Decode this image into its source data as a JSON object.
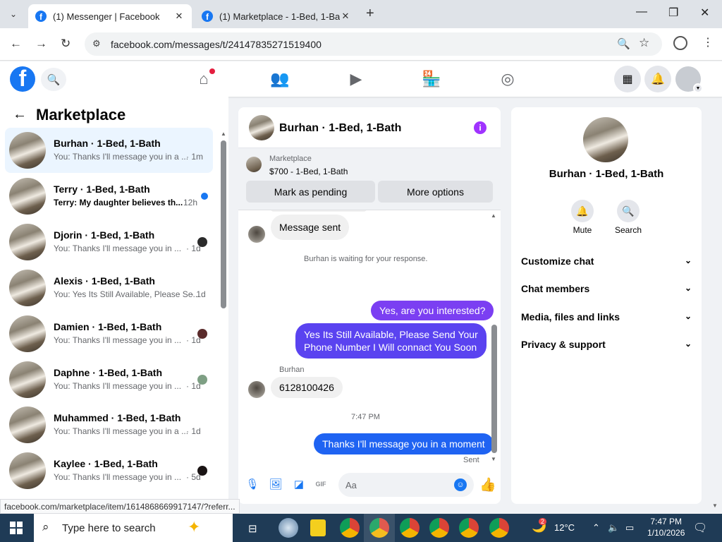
{
  "browser": {
    "tabs": [
      {
        "title": "(1) Messenger | Facebook",
        "active": true
      },
      {
        "title": "(1) Marketplace - 1-Bed, 1-Bath",
        "active": false
      }
    ],
    "url": "facebook.com/messages/t/24147835271519400",
    "hover_link": "facebook.com/marketplace/item/1614868669917147/?referr..."
  },
  "fb": {
    "logo_letter": "f"
  },
  "left": {
    "title": "Marketplace",
    "conversations": [
      {
        "name": "Burhan · 1-Bed, 1-Bath",
        "preview": "You: Thanks I'll message you in a ...",
        "time": "· 1m",
        "selected": true,
        "unread": false
      },
      {
        "name": "Terry · 1-Bed, 1-Bath",
        "preview": "Terry: My daughter believes th...",
        "time": "12h",
        "selected": false,
        "unread": true
      },
      {
        "name": "Djorin · 1-Bed, 1-Bath",
        "preview": "You: Thanks I'll message you in ...",
        "time": "· 1d",
        "selected": false,
        "unread": false,
        "mini": "#2b2b2b"
      },
      {
        "name": "Alexis · 1-Bed, 1-Bath",
        "preview": "You: Yes Its Still Available, Please Se...",
        "time": "· 1d",
        "selected": false,
        "unread": false
      },
      {
        "name": "Damien · 1-Bed, 1-Bath",
        "preview": "You: Thanks I'll message you in ...",
        "time": "· 1d",
        "selected": false,
        "unread": false,
        "mini": "#5a2b2b"
      },
      {
        "name": "Daphne · 1-Bed, 1-Bath",
        "preview": "You: Thanks I'll message you in ...",
        "time": "· 1d",
        "selected": false,
        "unread": false,
        "mini": "#7e9f84"
      },
      {
        "name": "Muhammed · 1-Bed, 1-Bath",
        "preview": "You: Thanks I'll message you in a ...",
        "time": "· 1d",
        "selected": false,
        "unread": false
      },
      {
        "name": "Kaylee · 1-Bed, 1-Bath",
        "preview": "You: Thanks I'll message you in ...",
        "time": "· 5d",
        "selected": false,
        "unread": false,
        "mini": "#1a1414"
      }
    ]
  },
  "chat": {
    "header_name": "Burhan · 1-Bed, 1-Bath",
    "listing": {
      "source": "Marketplace",
      "title": "$700 - 1-Bed, 1-Bath"
    },
    "mark_pending": "Mark as pending",
    "more_options": "More options",
    "messages": [
      {
        "kind": "in",
        "text": "Message sent"
      },
      {
        "kind": "system",
        "text": "Burhan is waiting for your response."
      },
      {
        "kind": "out",
        "text": "Yes, are you interested?",
        "color": "#7b3ff2"
      },
      {
        "kind": "out",
        "text": "Yes Its Still Available, Please Send Your",
        "text2": "Phone Number I Will connact You Soon",
        "color": "#5a43f0"
      },
      {
        "kind": "sender",
        "text": "Burhan"
      },
      {
        "kind": "in",
        "text": "6128100426"
      },
      {
        "kind": "system",
        "text": "7:47 PM"
      },
      {
        "kind": "out",
        "text": "Thanks I'll message you in a moment",
        "color": "#1f63f2"
      },
      {
        "kind": "status",
        "text": "Sent"
      }
    ],
    "compose_placeholder": "Aa"
  },
  "info": {
    "name": "Burhan · 1-Bed, 1-Bath",
    "mute": "Mute",
    "search": "Search",
    "sections": [
      "Customize chat",
      "Chat members",
      "Media, files and links",
      "Privacy & support"
    ]
  },
  "taskbar": {
    "search_placeholder": "Type here to search",
    "temperature": "12°C",
    "weather_badge": "2",
    "time": "7:47 PM",
    "date": "1/10/2026"
  },
  "colors": {
    "fb_blue": "#1877f2",
    "info_purple": "#a033ff",
    "selected_row": "#ebf5ff"
  }
}
